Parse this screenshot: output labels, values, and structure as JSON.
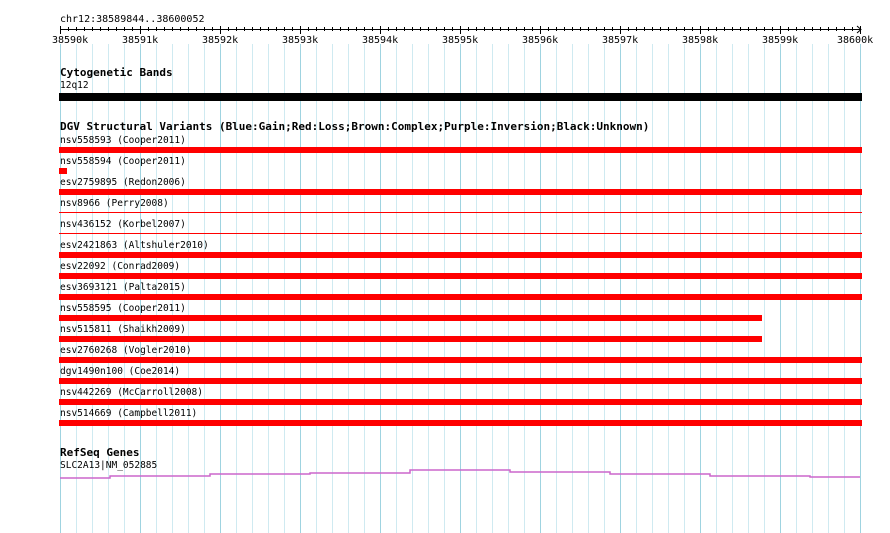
{
  "ruler": {
    "location": "chr12:38589844..38600052",
    "ticks": [
      "38590k",
      "38591k",
      "38592k",
      "38593k",
      "38594k",
      "38595k",
      "38596k",
      "38597k",
      "38598k",
      "38599k",
      "38600k"
    ]
  },
  "cytoband": {
    "title": "Cytogenetic Bands",
    "band": "12q12",
    "color": "#000000"
  },
  "dgv": {
    "title": "DGV Structural Variants (Blue:Gain;Red:Loss;Brown:Complex;Purple:Inversion;Black:Unknown)",
    "loss_color": "#ff0000",
    "variants": [
      {
        "label": "nsv558593 (Cooper2011)"
      },
      {
        "label": "nsv558594 (Cooper2011)"
      },
      {
        "label": "esv2759895 (Redon2006)"
      },
      {
        "label": "nsv8966 (Perry2008)"
      },
      {
        "label": "nsv436152 (Korbel2007)"
      },
      {
        "label": "esv2421863 (Altshuler2010)"
      },
      {
        "label": "esv22092 (Conrad2009)"
      },
      {
        "label": "esv3693121 (Palta2015)"
      },
      {
        "label": "nsv558595 (Cooper2011)"
      },
      {
        "label": "nsv515811 (Shaikh2009)"
      },
      {
        "label": "esv2760268 (Vogler2010)"
      },
      {
        "label": "dgv1490n100 (Coe2014)"
      },
      {
        "label": "nsv442269 (McCarroll2008)"
      },
      {
        "label": "nsv514669 (Campbell2011)"
      }
    ]
  },
  "refseq": {
    "title": "RefSeq Genes",
    "gene": "SLC2A13|NM_052885",
    "color": "#cc66cc"
  },
  "colors": {
    "grid_major": "#9fd3e0",
    "grid_minor": "#cfeaf1"
  }
}
